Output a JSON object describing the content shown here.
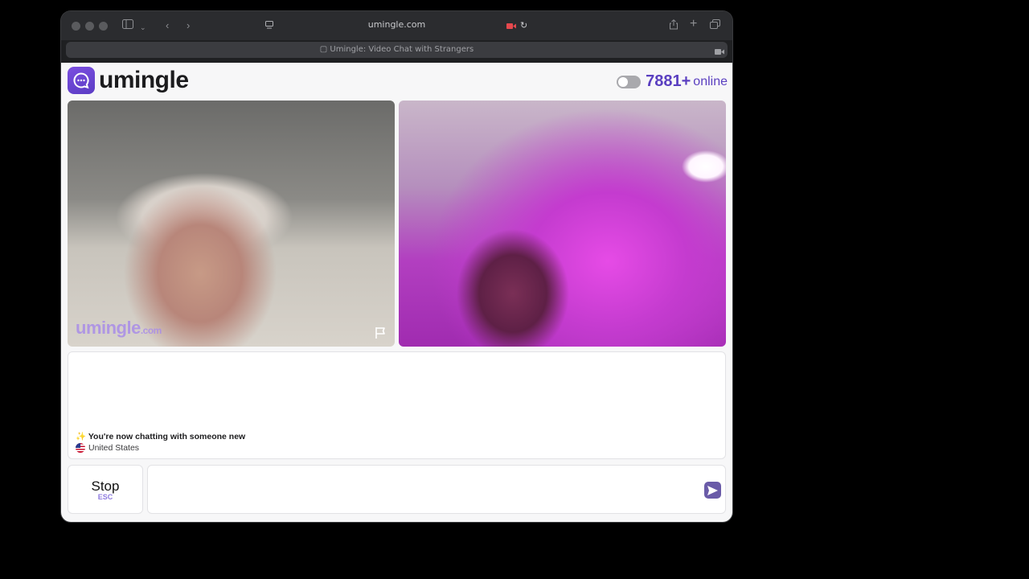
{
  "browser": {
    "url": "umingle.com",
    "tab_title": "Umingle: Video Chat with Strangers"
  },
  "header": {
    "logo_text": "umingle",
    "online_count": "7881+",
    "online_label": "online"
  },
  "video": {
    "watermark_main": "umingle",
    "watermark_suffix": ".com"
  },
  "chat": {
    "status_icon": "✨",
    "status_message": "You're now chatting with someone new",
    "country": "United States"
  },
  "controls": {
    "stop_label": "Stop",
    "stop_shortcut": "ESC",
    "message_placeholder": ""
  },
  "colors": {
    "brand": "#5a3fc0",
    "send_button": "#6a5ba8"
  }
}
